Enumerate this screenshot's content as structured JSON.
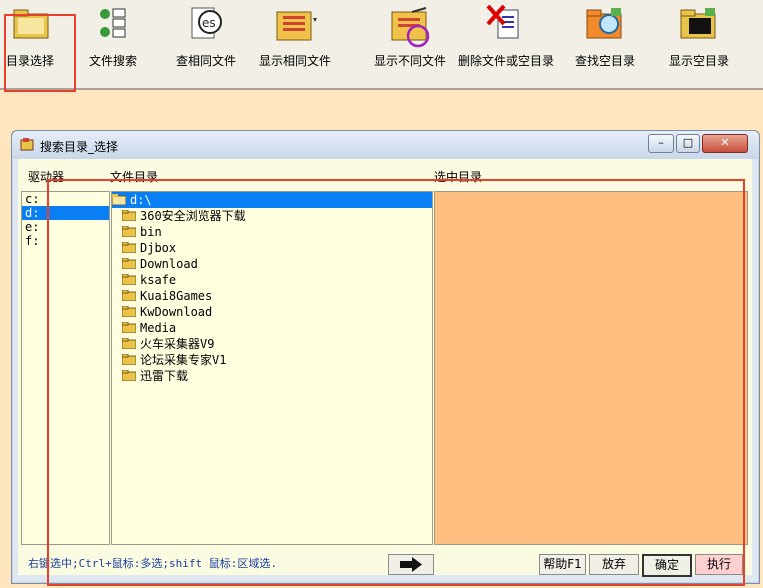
{
  "toolbar": {
    "items": [
      {
        "label": "目录选择",
        "icon": "folder-select-icon"
      },
      {
        "label": "文件搜索",
        "icon": "file-search-icon"
      },
      {
        "label": "查相同文件",
        "icon": "find-same-file-icon"
      },
      {
        "label": "显示相同文件",
        "icon": "show-same-file-icon"
      },
      {
        "label": "显示不同文件",
        "icon": "show-diff-file-icon"
      },
      {
        "label": "删除文件或空目录",
        "icon": "delete-file-icon"
      },
      {
        "label": "查找空目录",
        "icon": "find-empty-dir-icon"
      },
      {
        "label": "显示空目录",
        "icon": "show-empty-dir-icon"
      }
    ]
  },
  "window": {
    "title": "搜索目录_选择",
    "min": "–",
    "max": "□",
    "close": "✕"
  },
  "columns": {
    "drives": "驱动器",
    "files": "文件目录",
    "selected": "选中目录"
  },
  "drives": [
    "c:",
    "d:",
    "e:",
    "f:"
  ],
  "tree": {
    "root": "d:\\",
    "items": [
      "360安全浏览器下载",
      "bin",
      "Djbox",
      "Download",
      "ksafe",
      "Kuai8Games",
      "KwDownload",
      "Media",
      "火车采集器V9",
      "论坛采集专家V1",
      "迅雷下载"
    ]
  },
  "footer": {
    "hint": "右键选中;Ctrl+鼠标:多选;shift 鼠标:区域选.",
    "help": "帮助F1",
    "cancel": "放弃",
    "ok": "确定",
    "run": "执行"
  },
  "colors": {
    "selection": "#0a7ff3",
    "selected_pane": "#ffbf80",
    "highlight": "#e8402a"
  }
}
